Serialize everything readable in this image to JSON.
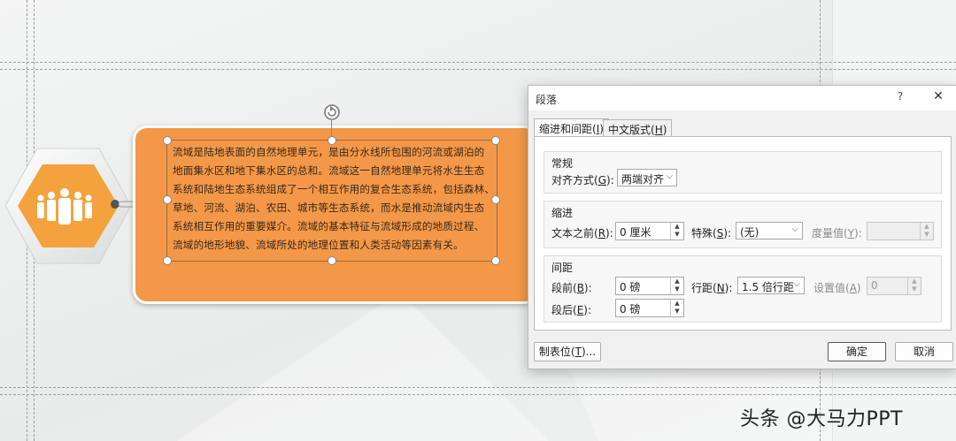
{
  "textbox": {
    "lines": [
      "流域是陆地表面的自然地理单元，是由分水线所包围的河流或湖泊的",
      "地面集水区和地下集水区的总和。流域这一自然地理单元将水生生态",
      "系统和陆地生态系统组成了一个相互作用的复合生态系统，包括森林、",
      "草地、河流、湖泊、农田、城市等生态系统，而水是推动流域内生态",
      "系统相互作用的重要媒介。流域的基本特征与流域形成的地质过程、",
      "流域的地形地貌、流域所处的地理位置和人类活动等因素有关。"
    ]
  },
  "colors": {
    "accent": "#f39848",
    "hex_fill": "#f4a23e"
  },
  "icons": {
    "people": "people-group-icon",
    "rotate": "rotate-handle-icon"
  },
  "dialog": {
    "title": "段落",
    "help": "?",
    "close": "✕",
    "tabs": [
      {
        "label": "缩进和间距(",
        "key": "I",
        "suffix": ")"
      },
      {
        "label": "中文版式(",
        "key": "H",
        "suffix": ")"
      }
    ],
    "general": {
      "title": "常规",
      "alignment_label": "对齐方式(",
      "alignment_key": "G",
      "alignment_suffix": "):",
      "alignment_value": "两端对齐"
    },
    "indent": {
      "title": "缩进",
      "before_label": "文本之前(",
      "before_key": "R",
      "before_suffix": "):",
      "before_value": "0 厘米",
      "special_label": "特殊(",
      "special_key": "S",
      "special_suffix": "):",
      "special_value": "(无)",
      "measure_label": "度量值(",
      "measure_key": "Y",
      "measure_suffix": "):",
      "measure_value": ""
    },
    "spacing": {
      "title": "间距",
      "before_label": "段前(",
      "before_key": "B",
      "before_suffix": "):",
      "before_value": "0 磅",
      "after_label": "段后(",
      "after_key": "E",
      "after_suffix": "):",
      "after_value": "0 磅",
      "line_label": "行距(",
      "line_key": "N",
      "line_suffix": "):",
      "line_value": "1.5 倍行距",
      "set_label": "设置值(",
      "set_key": "A",
      "set_suffix": ")",
      "set_value": "0"
    },
    "buttons": {
      "tabs_label": "制表位(",
      "tabs_key": "T",
      "tabs_suffix": ")...",
      "ok": "确定",
      "cancel": "取消"
    }
  },
  "watermark": "头条 @大马力PPT"
}
